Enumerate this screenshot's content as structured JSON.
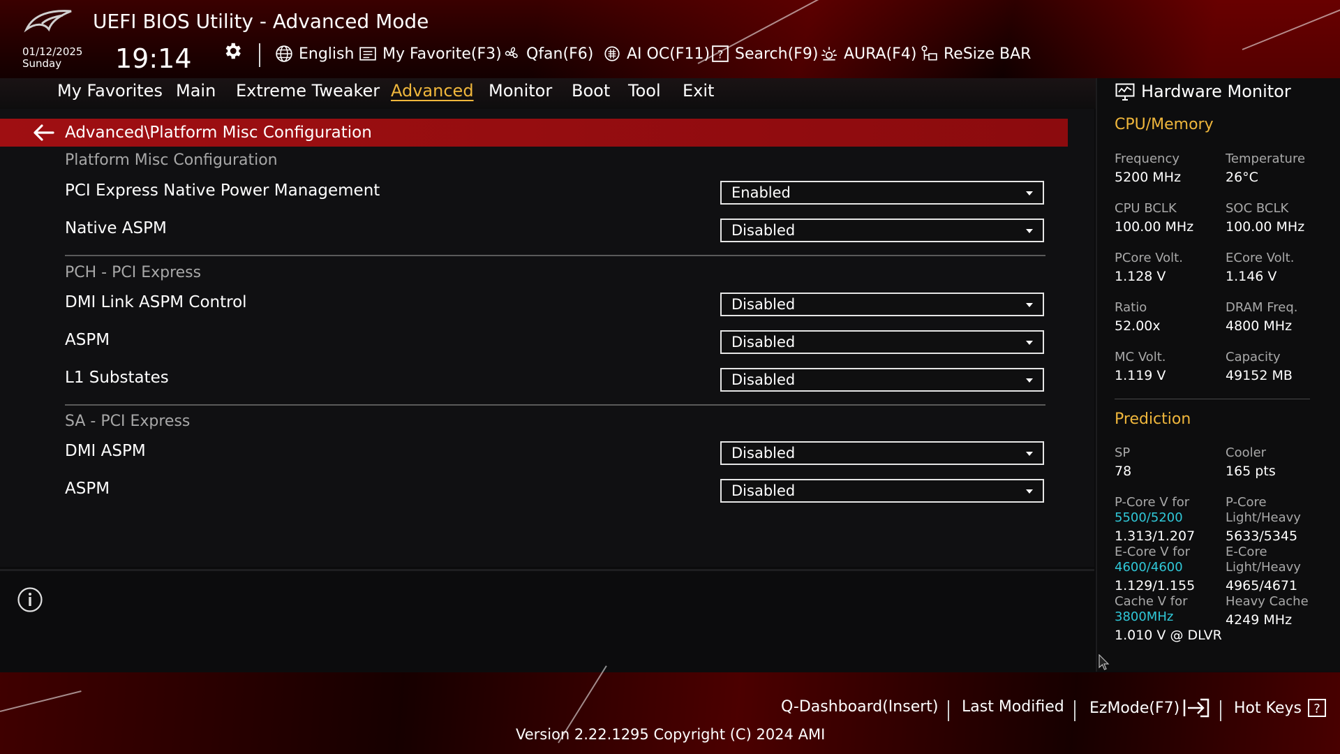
{
  "header": {
    "title": "UEFI BIOS Utility - Advanced Mode",
    "date": "01/12/2025",
    "day": "Sunday",
    "time": "19:14",
    "toolbar": {
      "language": "English",
      "favorite": "My Favorite(F3)",
      "qfan": "Qfan(F6)",
      "aioc": "AI OC(F11)",
      "search": "Search(F9)",
      "aura": "AURA(F4)",
      "resizebar": "ReSize BAR"
    }
  },
  "tabs": [
    {
      "label": "My Favorites"
    },
    {
      "label": "Main"
    },
    {
      "label": "Extreme Tweaker"
    },
    {
      "label": "Advanced",
      "active": true
    },
    {
      "label": "Monitor"
    },
    {
      "label": "Boot"
    },
    {
      "label": "Tool"
    },
    {
      "label": "Exit"
    }
  ],
  "breadcrumb": "Advanced\\Platform Misc Configuration",
  "sections": [
    {
      "title": "Platform Misc Configuration"
    },
    {
      "title": "PCH - PCI Express"
    },
    {
      "title": "SA - PCI Express"
    }
  ],
  "settings": [
    {
      "label": "PCI Express Native Power Management",
      "value": "Enabled"
    },
    {
      "label": "Native ASPM",
      "value": "Disabled"
    },
    {
      "label": "DMI Link ASPM Control",
      "value": "Disabled"
    },
    {
      "label": "ASPM",
      "value": "Disabled"
    },
    {
      "label": "L1 Substates",
      "value": "Disabled"
    },
    {
      "label": "DMI ASPM",
      "value": "Disabled"
    },
    {
      "label": "ASPM",
      "value": "Disabled"
    }
  ],
  "hardware_monitor": {
    "title": "Hardware Monitor",
    "cpu_memory": {
      "heading": "CPU/Memory",
      "frequency_label": "Frequency",
      "frequency": "5200 MHz",
      "temperature_label": "Temperature",
      "temperature": "26°C",
      "cpu_bclk_label": "CPU BCLK",
      "cpu_bclk": "100.00 MHz",
      "soc_bclk_label": "SOC BCLK",
      "soc_bclk": "100.00 MHz",
      "pcore_volt_label": "PCore Volt.",
      "pcore_volt": "1.128 V",
      "ecore_volt_label": "ECore Volt.",
      "ecore_volt": "1.146 V",
      "ratio_label": "Ratio",
      "ratio": "52.00x",
      "dram_freq_label": "DRAM Freq.",
      "dram_freq": "4800 MHz",
      "mc_volt_label": "MC Volt.",
      "mc_volt": "1.119 V",
      "capacity_label": "Capacity",
      "capacity": "49152 MB"
    },
    "prediction": {
      "heading": "Prediction",
      "sp_label": "SP",
      "sp": "78",
      "cooler_label": "Cooler",
      "cooler": "165 pts",
      "pcore_v_label": "P-Core V for",
      "pcore_v_freq": "5500/5200",
      "pcore_v": "1.313/1.207",
      "pcore_lh_label": "P-Core",
      "pcore_lh_label2": "Light/Heavy",
      "pcore_lh": "5633/5345",
      "ecore_v_label": "E-Core V for",
      "ecore_v_freq": "4600/4600",
      "ecore_v": "1.129/1.155",
      "ecore_lh_label": "E-Core",
      "ecore_lh_label2": "Light/Heavy",
      "ecore_lh": "4965/4671",
      "cache_v_label": "Cache V for",
      "cache_v_freq": "3800MHz",
      "cache_v": "1.010 V @ DLVR",
      "heavy_cache_label": "Heavy Cache",
      "heavy_cache": "4249 MHz"
    }
  },
  "footer": {
    "qdashboard": "Q-Dashboard(Insert)",
    "last_modified": "Last Modified",
    "ezmode": "EzMode(F7)",
    "hotkeys": "Hot Keys",
    "version": "Version 2.22.1295 Copyright (C) 2024 AMI"
  },
  "colors": {
    "accent": "#f0b73c",
    "highlight_bar": "#9f0f12",
    "frequency_text": "#30c8d8"
  }
}
